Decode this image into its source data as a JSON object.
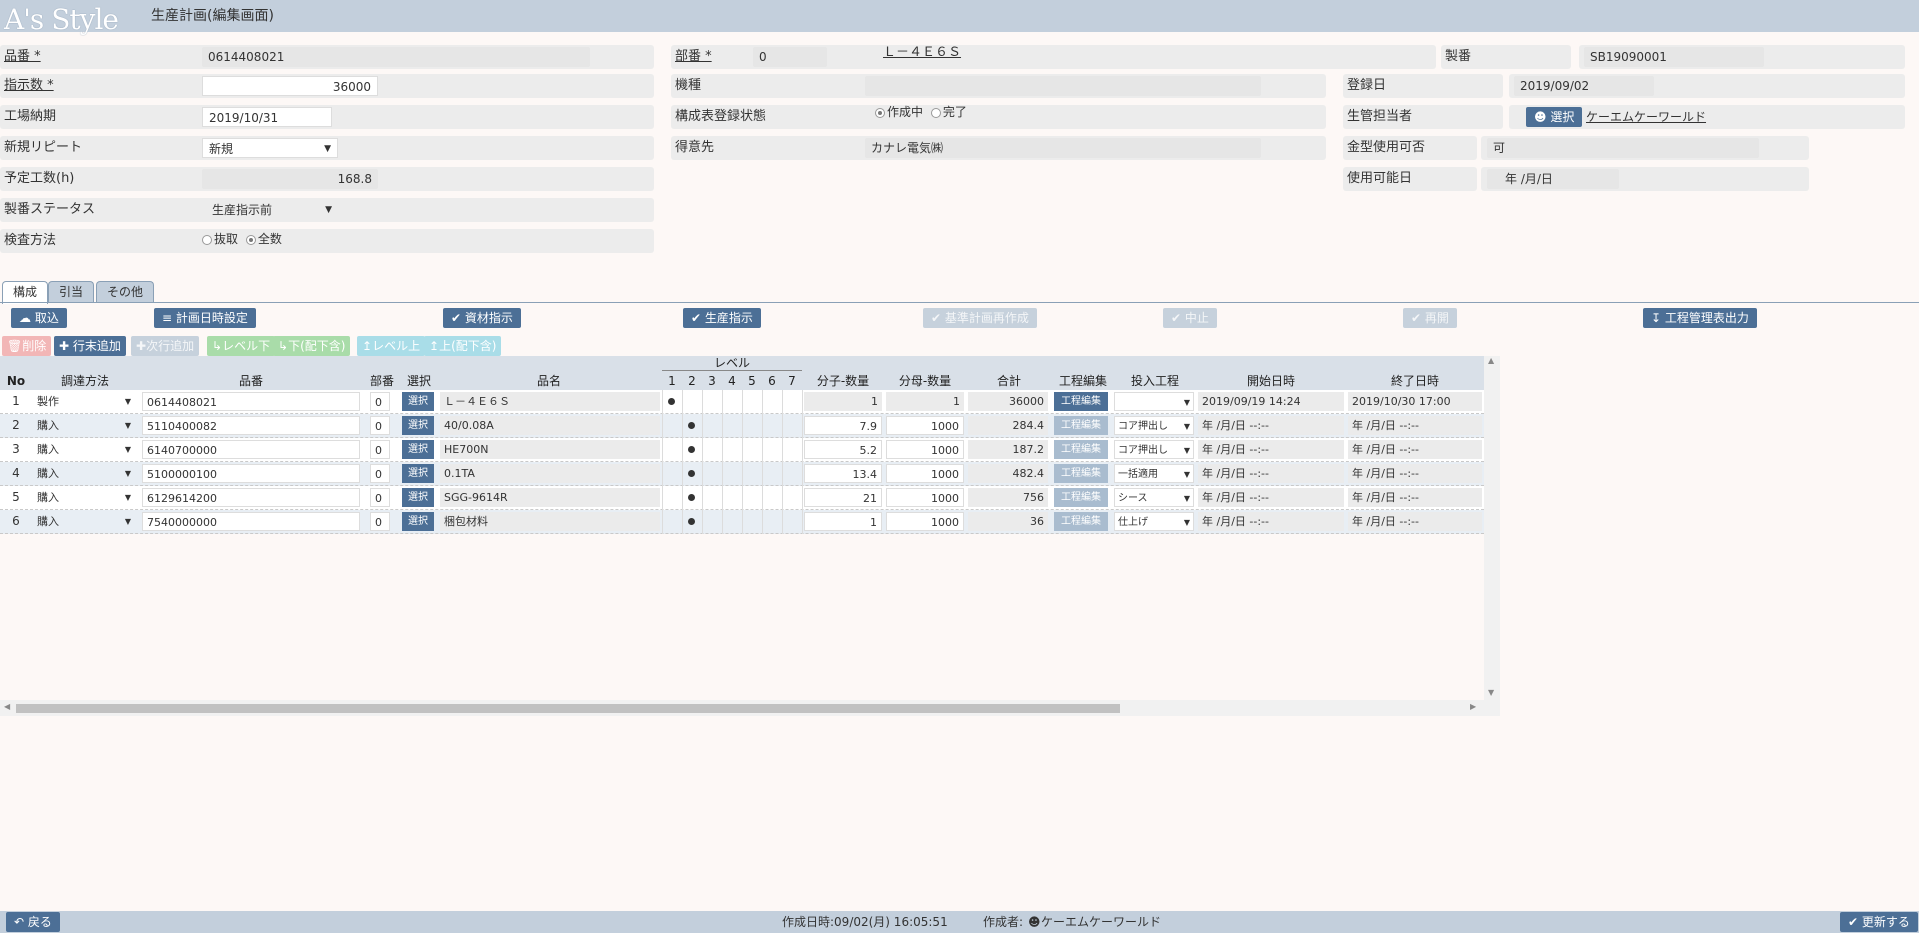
{
  "header": {
    "logo": "A's Style",
    "title": "生産計画(編集画面)"
  },
  "form": {
    "hinban_label": "品番 *",
    "hinban_value": "0614408021",
    "shijisu_label": "指示数 *",
    "shijisu_value": "36000",
    "kojo_noki_label": "工場納期",
    "kojo_noki_value": "2019/10/31",
    "shinki_label": "新規リピート",
    "shinki_value": "新規",
    "yotei_label": "予定工数(h)",
    "yotei_value": "168.8",
    "status_label": "製番ステータス",
    "status_value": "生産指示前",
    "kensa_label": "検査方法",
    "kensa_opt1": "抜取",
    "kensa_opt2": "全数",
    "buban_label": "部番 *",
    "buban_value": "0",
    "buban_name": "Ｌ－４Ｅ６Ｓ",
    "seiban_label": "製番",
    "seiban_value": "SB19090001",
    "kishu_label": "機種",
    "kishu_value": "",
    "touroku_label": "登録日",
    "touroku_value": "2019/09/02",
    "kosei_label": "構成表登録状態",
    "kosei_opt1": "作成中",
    "kosei_opt2": "完了",
    "tanto_label": "生管担当者",
    "tanto_button": "選択",
    "tanto_value": "ケーエムケーワールド",
    "tokui_label": "得意先",
    "tokui_value": "カナレ電気㈱",
    "kanagata_label": "金型使用可否",
    "kanagata_value": "可",
    "shiyo_label": "使用可能日",
    "shiyo_value": "年 /月/日"
  },
  "tabs": [
    "構成",
    "引当",
    "その他"
  ],
  "toolbar": {
    "torikomi": "取込",
    "keikaku": "計画日時設定",
    "shizai": "資材指示",
    "seisan": "生産指示",
    "kijun": "基準計画再作成",
    "chushi": "中止",
    "saikai": "再開",
    "kotei_out": "工程管理表出力"
  },
  "rowtools": {
    "sakujo": "削除",
    "gyomatsu": "行末追加",
    "jigyo": "次行追加",
    "level_down": "レベル下",
    "down_sub": "下(配下含)",
    "level_up": "レベル上",
    "up_sub": "上(配下含)"
  },
  "grid": {
    "level_group": "レベル",
    "headers": {
      "no": "No",
      "chotatsu": "調達方法",
      "hinban": "品番",
      "buban": "部番",
      "sentaku": "選択",
      "hinmei": "品名",
      "lv1": "1",
      "lv2": "2",
      "lv3": "3",
      "lv4": "4",
      "lv5": "5",
      "lv6": "6",
      "lv7": "7",
      "bunshi": "分子-数量",
      "bunbo": "分母-数量",
      "gokei": "合計",
      "kotei_henshu": "工程編集",
      "tonyu": "投入工程",
      "kaishi": "開始日時",
      "shuryo": "終了日時"
    },
    "select_label": "選択",
    "edit_label": "工程編集",
    "rows": [
      {
        "no": "1",
        "chotatsu": "製作",
        "hinban": "0614408021",
        "buban": "0",
        "hinmei": "Ｌ－４Ｅ６Ｓ",
        "level": 1,
        "bunshi": "1",
        "bunbo": "1",
        "gokei": "36000",
        "tonyu": "",
        "kaishi": "2019/09/19  14:24",
        "shuryo": "2019/10/30  17:00"
      },
      {
        "no": "2",
        "chotatsu": "購入",
        "hinban": "5110400082",
        "buban": "0",
        "hinmei": "40/0.08A",
        "level": 2,
        "bunshi": "7.9",
        "bunbo": "1000",
        "gokei": "284.4",
        "tonyu": "コア押出し",
        "kaishi": "年 /月/日  --:--",
        "shuryo": "年 /月/日  --:--"
      },
      {
        "no": "3",
        "chotatsu": "購入",
        "hinban": "6140700000",
        "buban": "0",
        "hinmei": "HE700N",
        "level": 2,
        "bunshi": "5.2",
        "bunbo": "1000",
        "gokei": "187.2",
        "tonyu": "コア押出し",
        "kaishi": "年 /月/日  --:--",
        "shuryo": "年 /月/日  --:--"
      },
      {
        "no": "4",
        "chotatsu": "購入",
        "hinban": "5100000100",
        "buban": "0",
        "hinmei": "0.1TA",
        "level": 2,
        "bunshi": "13.4",
        "bunbo": "1000",
        "gokei": "482.4",
        "tonyu": "一括適用",
        "kaishi": "年 /月/日  --:--",
        "shuryo": "年 /月/日  --:--"
      },
      {
        "no": "5",
        "chotatsu": "購入",
        "hinban": "6129614200",
        "buban": "0",
        "hinmei": "SGG-9614R",
        "level": 2,
        "bunshi": "21",
        "bunbo": "1000",
        "gokei": "756",
        "tonyu": "シース",
        "kaishi": "年 /月/日  --:--",
        "shuryo": "年 /月/日  --:--"
      },
      {
        "no": "6",
        "chotatsu": "購入",
        "hinban": "7540000000",
        "buban": "0",
        "hinmei": "梱包材料",
        "level": 2,
        "bunshi": "1",
        "bunbo": "1000",
        "gokei": "36",
        "tonyu": "仕上げ",
        "kaishi": "年 /月/日  --:--",
        "shuryo": "年 /月/日  --:--"
      }
    ]
  },
  "footer": {
    "back": "戻る",
    "created": "作成日時:09/02(月) 16:05:51",
    "author_label": "作成者:",
    "author": "ケーエムケーワールド",
    "update": "更新する"
  }
}
